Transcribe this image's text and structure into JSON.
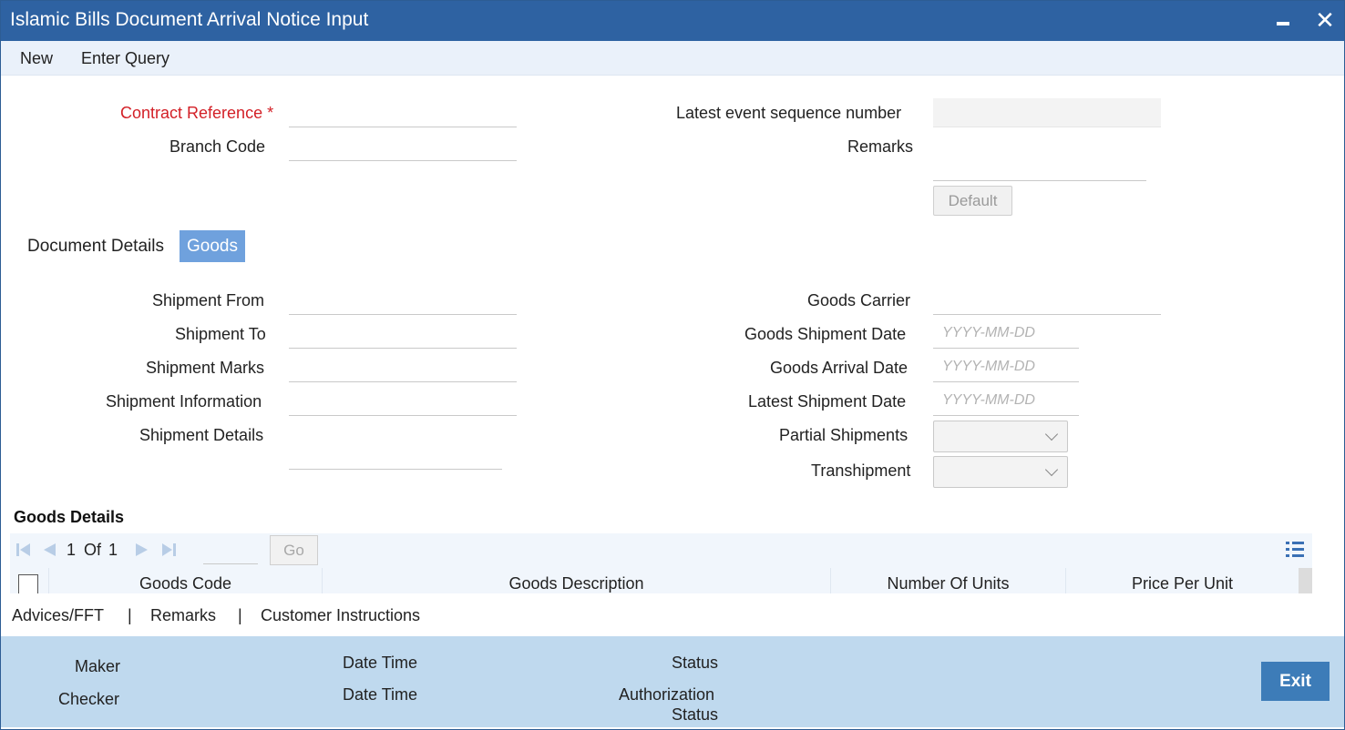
{
  "window": {
    "title": "Islamic Bills Document Arrival Notice Input",
    "minimize_label": "–",
    "close_label": "✕"
  },
  "menu": {
    "new_label": "New",
    "enter_query_label": "Enter Query"
  },
  "header": {
    "contract_reference_label": "Contract Reference",
    "required_mark": "*",
    "branch_code_label": "Branch Code",
    "latest_event_seq_label": "Latest event sequence number",
    "remarks_label": "Remarks",
    "default_button": "Default"
  },
  "tabs": {
    "document_details": "Document Details",
    "goods": "Goods"
  },
  "goods": {
    "shipment_from_label": "Shipment From",
    "shipment_to_label": "Shipment To",
    "shipment_marks_label": "Shipment Marks",
    "shipment_information_label": "Shipment Information",
    "shipment_details_label": "Shipment Details",
    "goods_carrier_label": "Goods Carrier",
    "goods_shipment_date_label": "Goods Shipment Date",
    "goods_arrival_date_label": "Goods Arrival Date",
    "latest_shipment_date_label": "Latest Shipment Date",
    "partial_shipments_label": "Partial Shipments",
    "transhipment_label": "Transhipment",
    "date_placeholder": "YYYY-MM-DD"
  },
  "goods_details": {
    "title": "Goods Details",
    "page_current": "1",
    "page_of": "Of",
    "page_total": "1",
    "go_label": "Go",
    "columns": [
      "Goods Code",
      "Goods Description",
      "Number Of Units",
      "Price Per Unit"
    ]
  },
  "bottom_links": {
    "advices": "Advices/FFT",
    "remarks": "Remarks",
    "customer_instructions": "Customer Instructions",
    "separator": "|"
  },
  "footer": {
    "maker_label": "Maker",
    "checker_label": "Checker",
    "date_time_label": "Date Time",
    "status_label": "Status",
    "authorization_label": "Authorization",
    "authorization_status_label": "Status",
    "exit_label": "Exit"
  }
}
